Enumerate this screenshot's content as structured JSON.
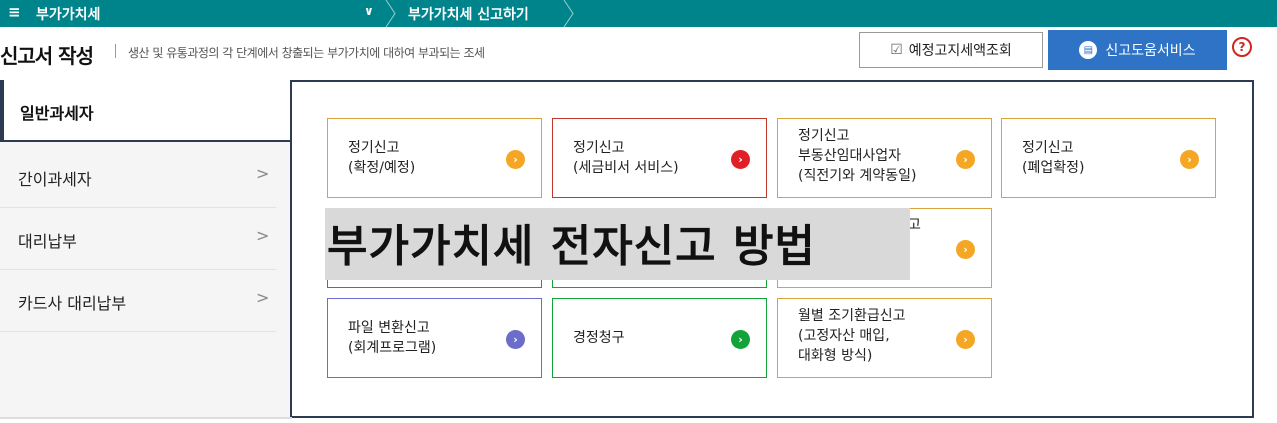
{
  "topbar": {
    "menu_label": "부가가치세",
    "breadcrumb": "부가가치세 신고하기"
  },
  "header": {
    "title": "신고서 작성",
    "subtitle": "생산 및 유통과정의 각 단계에서 창출되는 부가가치에 대하여 부과되는 조세",
    "lookup_button": "예정고지세액조회",
    "help_button": "신고도움서비스",
    "question_mark": "?"
  },
  "sidebar": {
    "active_tab": "일반과세자",
    "items": [
      {
        "label": "간이과세자"
      },
      {
        "label": "대리납부"
      },
      {
        "label": "카드사 대리납부"
      }
    ]
  },
  "cards": [
    {
      "text": "정기신고\n(확정/예정)",
      "dot": "orange"
    },
    {
      "text": "정기신고\n(세금비서 서비스)",
      "dot": "red"
    },
    {
      "text": "정기신고\n부동산임대사업자\n(직전기와 계약동일)",
      "dot": "orange"
    },
    {
      "text": "정기신고\n(폐업확정)",
      "dot": "orange"
    },
    {
      "text": "",
      "dot": "none"
    },
    {
      "text": "",
      "dot": "none"
    },
    {
      "text": "고",
      "dot": "orange"
    },
    {
      "text": "파일 변환신고\n(회계프로그램)",
      "dot": "purple"
    },
    {
      "text": "경정청구",
      "dot": "green"
    },
    {
      "text": "월별 조기환급신고\n(고정자산 매입,\n대화형 방식)",
      "dot": "orange"
    }
  ],
  "overlay_caption": "부가가치세 전자신고 방법",
  "colors": {
    "topbar": "#00848c",
    "help_button": "#2e73c6",
    "card_border_orange": "#d9a23d",
    "card_border_red": "#c0392b",
    "card_border_purple": "#6b6ccc",
    "card_border_green": "#14a33a"
  }
}
